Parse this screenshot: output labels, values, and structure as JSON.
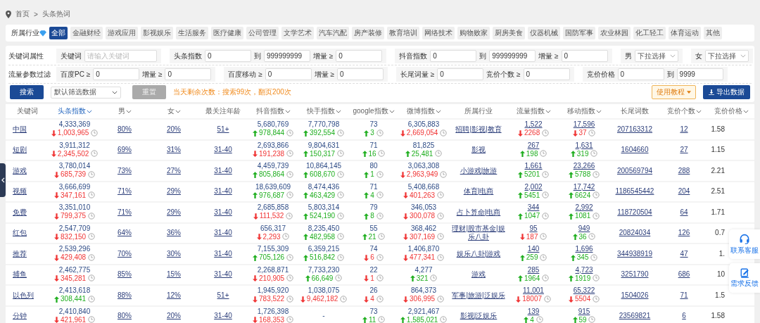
{
  "breadcrumb": {
    "items": [
      "首页",
      "头条热词"
    ],
    "separator": ">"
  },
  "industry_filter": {
    "label": "所属行业",
    "tags": [
      {
        "label": "全部",
        "selected": true
      },
      {
        "label": "金融财经",
        "selected": false
      },
      {
        "label": "游戏应用",
        "selected": false
      },
      {
        "label": "影视娱乐",
        "selected": false
      },
      {
        "label": "生活服务",
        "selected": false
      },
      {
        "label": "医疗健康",
        "selected": false
      },
      {
        "label": "公司管理",
        "selected": false
      },
      {
        "label": "文学艺术",
        "selected": false
      },
      {
        "label": "汽车汽配",
        "selected": false
      },
      {
        "label": "房产装修",
        "selected": false
      },
      {
        "label": "教育培训",
        "selected": false
      },
      {
        "label": "网络技术",
        "selected": false
      },
      {
        "label": "购物败家",
        "selected": false
      },
      {
        "label": "厨房美食",
        "selected": false
      },
      {
        "label": "仪器机械",
        "selected": false
      },
      {
        "label": "国防军事",
        "selected": false
      },
      {
        "label": "农业林园",
        "selected": false
      },
      {
        "label": "化工轻工",
        "selected": false
      },
      {
        "label": "体育运动",
        "selected": false
      },
      {
        "label": "其他",
        "selected": false
      }
    ]
  },
  "filters": [
    {
      "title": "关键词属性",
      "groups": [
        {
          "fields": [
            {
              "kind": "input",
              "label": "关键词",
              "placeholder": "请输入关键词",
              "wide": true
            }
          ]
        },
        {
          "fields": [
            {
              "kind": "input",
              "label": "头条指数",
              "value": "0"
            },
            {
              "kind": "input",
              "label": "到",
              "value": "999999999"
            },
            {
              "kind": "input",
              "label": "增量 ≥",
              "value": "0"
            }
          ]
        },
        {
          "fields": [
            {
              "kind": "input",
              "label": "抖音指数",
              "value": "0"
            },
            {
              "kind": "input",
              "label": "到",
              "value": "999999999"
            },
            {
              "kind": "input",
              "label": "增量 ≥",
              "value": "0"
            }
          ]
        },
        {
          "fields": [
            {
              "kind": "select",
              "label": "男",
              "value": "下拉选择"
            }
          ]
        },
        {
          "fields": [
            {
              "kind": "select",
              "label": "女",
              "value": "下拉选择"
            }
          ]
        }
      ]
    },
    {
      "title": "流量参数过滤",
      "groups": [
        {
          "fields": [
            {
              "kind": "input",
              "label": "百度PC ≥",
              "value": "0"
            },
            {
              "kind": "input",
              "label": "增量 ≥",
              "value": "0"
            }
          ]
        },
        {
          "fields": [
            {
              "kind": "input",
              "label": "百度移动 ≥",
              "value": "0"
            },
            {
              "kind": "input",
              "label": "增量 ≥",
              "value": "0"
            }
          ]
        },
        {
          "fields": [
            {
              "kind": "input",
              "label": "长尾词量 ≥",
              "value": "0"
            },
            {
              "kind": "input",
              "label": "竞价个数 ≥",
              "value": "0"
            }
          ]
        },
        {
          "fields": [
            {
              "kind": "input",
              "label": "竞价价格",
              "value": "0"
            },
            {
              "kind": "input",
              "label": "到",
              "value": "9999"
            }
          ]
        }
      ]
    }
  ],
  "actions": {
    "search": "搜索",
    "preset": "默认筛选数据",
    "reset": "重置",
    "quota": "当天剩余次数：搜索99次，翻页200次",
    "tutorial": "使用教程",
    "export": "导出数据"
  },
  "table": {
    "columns": [
      {
        "label": "关键词",
        "sortable": false,
        "selected": false
      },
      {
        "label": "头条指数",
        "sortable": true,
        "selected": true
      },
      {
        "label": "男",
        "sortable": true,
        "selected": false
      },
      {
        "label": "女",
        "sortable": true,
        "selected": false
      },
      {
        "label": "最关注年龄",
        "sortable": false,
        "selected": false
      },
      {
        "label": "抖音指数",
        "sortable": true,
        "selected": false
      },
      {
        "label": "快手指数",
        "sortable": true,
        "selected": false
      },
      {
        "label": "google指数",
        "sortable": true,
        "selected": false
      },
      {
        "label": "微博指数",
        "sortable": true,
        "selected": false
      },
      {
        "label": "所属行业",
        "sortable": false,
        "selected": false
      },
      {
        "label": "流量指数",
        "sortable": true,
        "selected": false
      },
      {
        "label": "移动指数",
        "sortable": true,
        "selected": false
      },
      {
        "label": "长尾词数",
        "sortable": false,
        "selected": false
      },
      {
        "label": "竞价个数",
        "sortable": true,
        "selected": false
      },
      {
        "label": "竞价价格",
        "sortable": true,
        "selected": false
      }
    ],
    "rows": [
      {
        "keyword": "中国",
        "toutiao": {
          "value": "4,333,369",
          "delta": "1,003,965",
          "rising": false
        },
        "male": "80%",
        "female": "20%",
        "age": "51+",
        "douyin": {
          "value": "5,680,769",
          "delta": "978,844",
          "rising": true
        },
        "kuaishou": {
          "value": "7,770,798",
          "delta": "392,554",
          "rising": true
        },
        "google": {
          "value": "73",
          "delta": "3",
          "rising": true
        },
        "weibo": {
          "value": "6,305,883",
          "delta": "2,669,054",
          "rising": false
        },
        "industry": "招聘|影视|教育",
        "traffic": {
          "value": "1,522",
          "delta": "2268",
          "rising": false
        },
        "mobile": {
          "value": "17,596",
          "delta": "37",
          "rising": false
        },
        "longtail": "207163312",
        "bid_count": "12",
        "bid_price": "1.58"
      },
      {
        "keyword": "短剧",
        "toutiao": {
          "value": "3,911,312",
          "delta": "2,345,502",
          "rising": false
        },
        "male": "69%",
        "female": "31%",
        "age": "31-40",
        "douyin": {
          "value": "2,693,866",
          "delta": "191,238",
          "rising": false
        },
        "kuaishou": {
          "value": "9,804,631",
          "delta": "150,317",
          "rising": true
        },
        "google": {
          "value": "71",
          "delta": "16",
          "rising": true
        },
        "weibo": {
          "value": "81,825",
          "delta": "25,481",
          "rising": true
        },
        "industry": "影视",
        "traffic": {
          "value": "267",
          "delta": "198",
          "rising": true
        },
        "mobile": {
          "value": "1,631",
          "delta": "319",
          "rising": true
        },
        "longtail": "1604660",
        "bid_count": "27",
        "bid_price": "1.15"
      },
      {
        "keyword": "游戏",
        "toutiao": {
          "value": "3,780,014",
          "delta": "685,739",
          "rising": false
        },
        "male": "73%",
        "female": "27%",
        "age": "31-40",
        "douyin": {
          "value": "4,459,739",
          "delta": "805,864",
          "rising": true
        },
        "kuaishou": {
          "value": "10,864,145",
          "delta": "608,670",
          "rising": true
        },
        "google": {
          "value": "80",
          "delta": "1",
          "rising": true
        },
        "weibo": {
          "value": "3,063,308",
          "delta": "2,963,949",
          "rising": false
        },
        "industry": "小游戏|旅游",
        "traffic": {
          "value": "1,661",
          "delta": "5201",
          "rising": true
        },
        "mobile": {
          "value": "23,266",
          "delta": "5788",
          "rising": true
        },
        "longtail": "200569794",
        "bid_count": "288",
        "bid_price": "2.21"
      },
      {
        "keyword": "视频",
        "toutiao": {
          "value": "3,666,699",
          "delta": "347,161",
          "rising": false
        },
        "male": "71%",
        "female": "29%",
        "age": "31-40",
        "douyin": {
          "value": "18,639,609",
          "delta": "976,687",
          "rising": true
        },
        "kuaishou": {
          "value": "8,474,436",
          "delta": "463,429",
          "rising": true
        },
        "google": {
          "value": "71",
          "delta": "4",
          "rising": true
        },
        "weibo": {
          "value": "5,408,668",
          "delta": "401,263",
          "rising": false
        },
        "industry": "体育|电商",
        "traffic": {
          "value": "2,002",
          "delta": "5451",
          "rising": true
        },
        "mobile": {
          "value": "17,742",
          "delta": "6624",
          "rising": true
        },
        "longtail": "1186545442",
        "bid_count": "204",
        "bid_price": "2.51"
      },
      {
        "keyword": "免费",
        "toutiao": {
          "value": "3,351,010",
          "delta": "799,375",
          "rising": false
        },
        "male": "71%",
        "female": "29%",
        "age": "31-40",
        "douyin": {
          "value": "2,685,858",
          "delta": "111,532",
          "rising": false
        },
        "kuaishou": {
          "value": "5,803,314",
          "delta": "524,190",
          "rising": true
        },
        "google": {
          "value": "79",
          "delta": "8",
          "rising": true
        },
        "weibo": {
          "value": "346,053",
          "delta": "300,078",
          "rising": false
        },
        "industry": "占卜算命|电商",
        "traffic": {
          "value": "344",
          "delta": "1047",
          "rising": true
        },
        "mobile": {
          "value": "2,992",
          "delta": "1081",
          "rising": true
        },
        "longtail": "118720504",
        "bid_count": "64",
        "bid_price": "1.71"
      },
      {
        "keyword": "红包",
        "toutiao": {
          "value": "2,547,709",
          "delta": "832,150",
          "rising": false
        },
        "male": "64%",
        "female": "36%",
        "age": "31-40",
        "douyin": {
          "value": "656,317",
          "delta": "2,293",
          "rising": false
        },
        "kuaishou": {
          "value": "8,235,450",
          "delta": "482,958",
          "rising": true
        },
        "google": {
          "value": "55",
          "delta": "21",
          "rising": true
        },
        "weibo": {
          "value": "368,462",
          "delta": "307,169",
          "rising": false
        },
        "industry": "理财|股市基金|娱乐八卦",
        "traffic": {
          "value": "95",
          "delta": "187",
          "rising": false
        },
        "mobile": {
          "value": "949",
          "delta": "36",
          "rising": true
        },
        "longtail": "20824034",
        "bid_count": "126",
        "bid_price": "0.7"
      },
      {
        "keyword": "推荐",
        "toutiao": {
          "value": "2,539,296",
          "delta": "429,408",
          "rising": false
        },
        "male": "70%",
        "female": "30%",
        "age": "31-40",
        "douyin": {
          "value": "7,155,309",
          "delta": "705,126",
          "rising": true
        },
        "kuaishou": {
          "value": "6,359,215",
          "delta": "516,842",
          "rising": true
        },
        "google": {
          "value": "74",
          "delta": "6",
          "rising": false
        },
        "weibo": {
          "value": "1,406,870",
          "delta": "477,341",
          "rising": false
        },
        "industry": "娱乐八卦|游戏",
        "traffic": {
          "value": "140",
          "delta": "259",
          "rising": true
        },
        "mobile": {
          "value": "1,696",
          "delta": "345",
          "rising": true
        },
        "longtail": "344938919",
        "bid_count": "47",
        "bid_price": "1."
      },
      {
        "keyword": "捕鱼",
        "toutiao": {
          "value": "2,462,775",
          "delta": "345,281",
          "rising": false
        },
        "male": "85%",
        "female": "15%",
        "age": "31-40",
        "douyin": {
          "value": "2,268,871",
          "delta": "210,905",
          "rising": false
        },
        "kuaishou": {
          "value": "7,733,230",
          "delta": "66,649",
          "rising": true
        },
        "google": {
          "value": "22",
          "delta": "1",
          "rising": false
        },
        "weibo": {
          "value": "4,277",
          "delta": "321",
          "rising": true
        },
        "industry": "游戏",
        "traffic": {
          "value": "285",
          "delta": "1964",
          "rising": true
        },
        "mobile": {
          "value": "4,723",
          "delta": "1919",
          "rising": true
        },
        "longtail": "3251790",
        "bid_count": "686",
        "bid_price": "10"
      },
      {
        "keyword": "以色列",
        "toutiao": {
          "value": "2,413,618",
          "delta": "308,441",
          "rising": true
        },
        "male": "88%",
        "female": "12%",
        "age": "51+",
        "douyin": {
          "value": "1,945,920",
          "delta": "783,522",
          "rising": false
        },
        "kuaishou": {
          "value": "1,038,075",
          "delta": "9,462,182",
          "rising": false
        },
        "google": {
          "value": "26",
          "delta": "4",
          "rising": false
        },
        "weibo": {
          "value": "864,373",
          "delta": "306,995",
          "rising": false
        },
        "industry": "军事|旅游|泛娱乐",
        "traffic": {
          "value": "11,001",
          "delta": "18007",
          "rising": false
        },
        "mobile": {
          "value": "65,322",
          "delta": "5504",
          "rising": false
        },
        "longtail": "1504026",
        "bid_count": "71",
        "bid_price": "1.5"
      },
      {
        "keyword": "分钟",
        "toutiao": {
          "value": "2,410,840",
          "delta": "421,961",
          "rising": false
        },
        "male": "80%",
        "female": "20%",
        "age": "31-40",
        "douyin": {
          "value": "1,726,398",
          "delta": "168,353",
          "rising": false
        },
        "kuaishou": {
          "value": "-"
        },
        "google": {
          "value": "73",
          "delta": "11",
          "rising": true
        },
        "weibo": {
          "value": "2,921,467",
          "delta": "1,585,021",
          "rising": true
        },
        "industry": "影视|泛娱乐",
        "traffic": {
          "value": "139",
          "delta": "4",
          "rising": true
        },
        "mobile": {
          "value": "915",
          "delta": "59",
          "rising": true
        },
        "longtail": "23569821",
        "bid_count": "6",
        "bid_price": "1.58"
      }
    ]
  },
  "side_widgets": [
    {
      "kind": "support",
      "label": "联系客服"
    },
    {
      "kind": "feedback",
      "label": "需求反馈"
    }
  ]
}
